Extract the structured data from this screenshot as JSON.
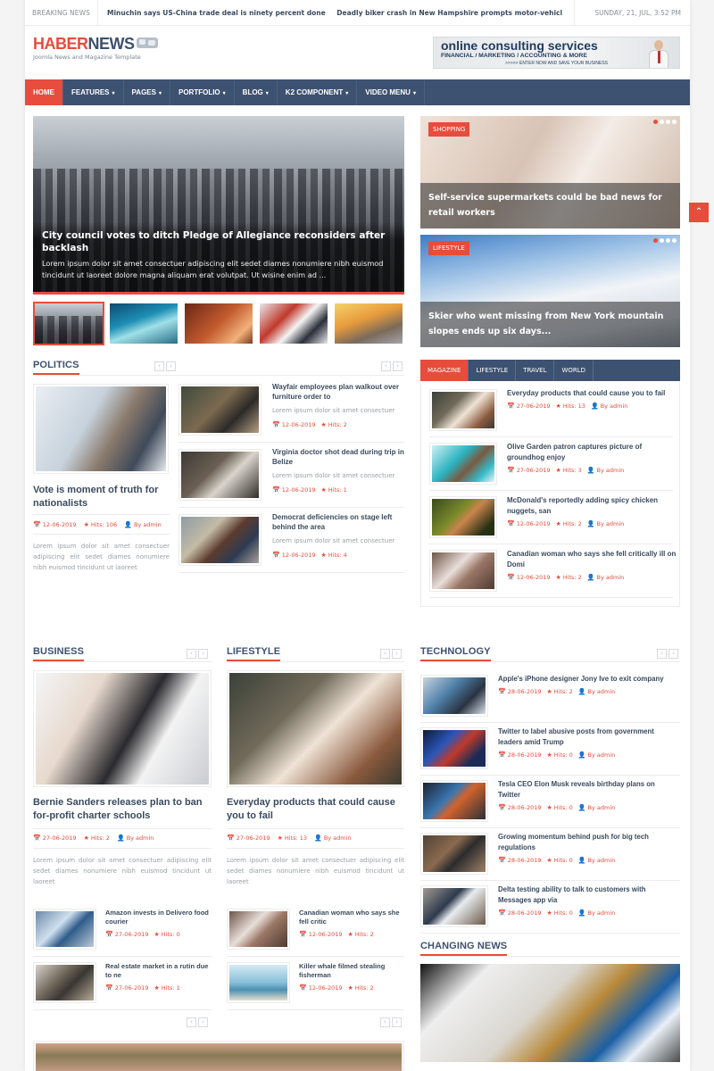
{
  "topbar": {
    "breaking_label": "BREAKING NEWS",
    "ticker": [
      "Minuchin says US-China trade deal is ninety percent done",
      "Deadly biker crash in New Hampshire prompts motor-vehicle chief in Massachusetts to"
    ],
    "date": "SUNDAY, 21, JUL, 3:52 PM"
  },
  "logo": {
    "part1": "HABER",
    "part2": "NEWS",
    "tagline": "Joomla News and Magazine Template"
  },
  "ad": {
    "line1": "online consulting services",
    "line2": "FINANCIAL / MARKETING / ACCOUNTING & MORE",
    "line3": ">>>>> ENTER NOW AND SAVE YOUR BUSINESS"
  },
  "nav": {
    "items": [
      {
        "label": "HOME",
        "active": true,
        "dropdown": false
      },
      {
        "label": "FEATURES",
        "dropdown": true
      },
      {
        "label": "PAGES",
        "dropdown": true
      },
      {
        "label": "PORTFOLIO",
        "dropdown": true
      },
      {
        "label": "BLOG",
        "dropdown": true
      },
      {
        "label": "K2 COMPONENT",
        "dropdown": true
      },
      {
        "label": "VIDEO MENU",
        "dropdown": true
      }
    ],
    "caret": "▾"
  },
  "hero": {
    "title": "City council votes to ditch Pledge of Allegiance reconsiders after backlash",
    "description": "Lorem ipsum dolor sit amet consectuer adipiscing elit sedet diames nonumiere nibh euismod tincidunt ut laoreet dolore magna aliquam erat volutpat. Ut wisine enim ad ...",
    "thumbnails": [
      "city",
      "ocean",
      "music",
      "sports",
      "skateboard"
    ],
    "active_thumbnail": 0
  },
  "feature_cards": [
    {
      "tag": "SHOPPING",
      "title": "Self-service supermarkets could be bad news for retail workers",
      "active_dot": 0,
      "dots": 4
    },
    {
      "tag": "LIFESTYLE",
      "title": "Skier who went missing from New York mountain slopes ends up six days...",
      "active_dot": 0,
      "dots": 4
    }
  ],
  "icons": {
    "calendar": "📅",
    "star": "★",
    "user": "👤",
    "prev": "‹",
    "next": "›",
    "up": "⌃"
  },
  "politics": {
    "title": "POLITICS",
    "main": {
      "title": "Vote is moment of truth for nationalists",
      "date": "12-06-2019",
      "hits": "Hits: 106",
      "author": "By admin",
      "text": "Lorem ipsum dolor sit amet consectuer adipiscing elit sedet diames nonumiere nibh euismod tincidunt ut laoreet"
    },
    "items": [
      {
        "title": "Wayfair employees plan walkout over furniture order to",
        "text": "Lorem ipsum dolor sit amet consectuer",
        "date": "12-06-2019",
        "hits": "Hits: 2"
      },
      {
        "title": "Virginia doctor shot dead during trip in Belize",
        "text": "Lorem ipsum dolor sit amet consectuer",
        "date": "12-06-2019",
        "hits": "Hits: 1"
      },
      {
        "title": "Democrat deficiencies on stage left behind the area",
        "text": "Lorem ipsum dolor sit amet consectuer",
        "date": "12-06-2019",
        "hits": "Hits: 4"
      }
    ]
  },
  "tabs": {
    "labels": [
      "MAGAZINE",
      "LIFESTYLE",
      "TRAVEL",
      "WORLD"
    ],
    "active": 0,
    "items": [
      {
        "title": "Everyday products that could cause you to fail",
        "date": "27-06-2019",
        "hits": "Hits: 13",
        "author": "By admin"
      },
      {
        "title": "Olive Garden patron captures picture of groundhog enjoy",
        "date": "27-06-2019",
        "hits": "Hits: 3",
        "author": "By admin"
      },
      {
        "title": "McDonald's reportedly adding spicy chicken nuggets, san",
        "date": "12-06-2019",
        "hits": "Hits: 2",
        "author": "By admin"
      },
      {
        "title": "Canadian woman who says she fell critically ill on Domi",
        "date": "12-06-2019",
        "hits": "Hits: 2",
        "author": "By admin"
      }
    ]
  },
  "business": {
    "title": "BUSINESS",
    "main": {
      "title": "Bernie Sanders releases plan to ban for-profit charter schools",
      "date": "27-06-2019",
      "hits": "Hits: 2",
      "author": "By admin",
      "text": "Lorem ipsum dolor sit amet consectuer adipiscing elit sedet diames nonumiere nibh euismod tincidunt ut laoreet"
    },
    "items": [
      {
        "title": "Amazon invests in Delivero food courier",
        "date": "27-06-2019",
        "hits": "Hits: 0"
      },
      {
        "title": "Real estate market in a rutin due to ne",
        "date": "27-06-2019",
        "hits": "Hits: 1"
      }
    ]
  },
  "lifestyle": {
    "title": "LIFESTYLE",
    "main": {
      "title": "Everyday products that could cause you to fail",
      "date": "27-06-2019",
      "hits": "Hits: 13",
      "author": "By admin",
      "text": "Lorem ipsum dolor sit amet consectuer adipiscing elit sedet diames nonumiere nibh euismod tincidunt ut laoreet"
    },
    "items": [
      {
        "title": "Canadian woman who says she fell critic",
        "date": "12-06-2019",
        "hits": "Hits: 2"
      },
      {
        "title": "Killer whale filmed stealing fisherman",
        "date": "12-06-2019",
        "hits": "Hits: 2"
      }
    ]
  },
  "technology": {
    "title": "TECHNOLOGY",
    "items": [
      {
        "title": "Apple's iPhone designer Jony Ive to exit company",
        "date": "28-06-2019",
        "hits": "Hits: 2",
        "author": "By admin"
      },
      {
        "title": "Twitter to label abusive posts from government leaders amid Trump",
        "date": "28-06-2019",
        "hits": "Hits: 0",
        "author": "By admin"
      },
      {
        "title": "Tesla CEO Elon Musk reveals birthday plans on Twitter",
        "date": "28-06-2019",
        "hits": "Hits: 0",
        "author": "By admin"
      },
      {
        "title": "Growing momentum behind push for big tech regulations",
        "date": "28-06-2019",
        "hits": "Hits: 0",
        "author": "By admin"
      },
      {
        "title": "Delta testing ability to talk to customers with Messages app via",
        "date": "28-06-2019",
        "hits": "Hits: 0",
        "author": "By admin"
      }
    ]
  },
  "changing_news": {
    "title": "CHANGING NEWS"
  }
}
